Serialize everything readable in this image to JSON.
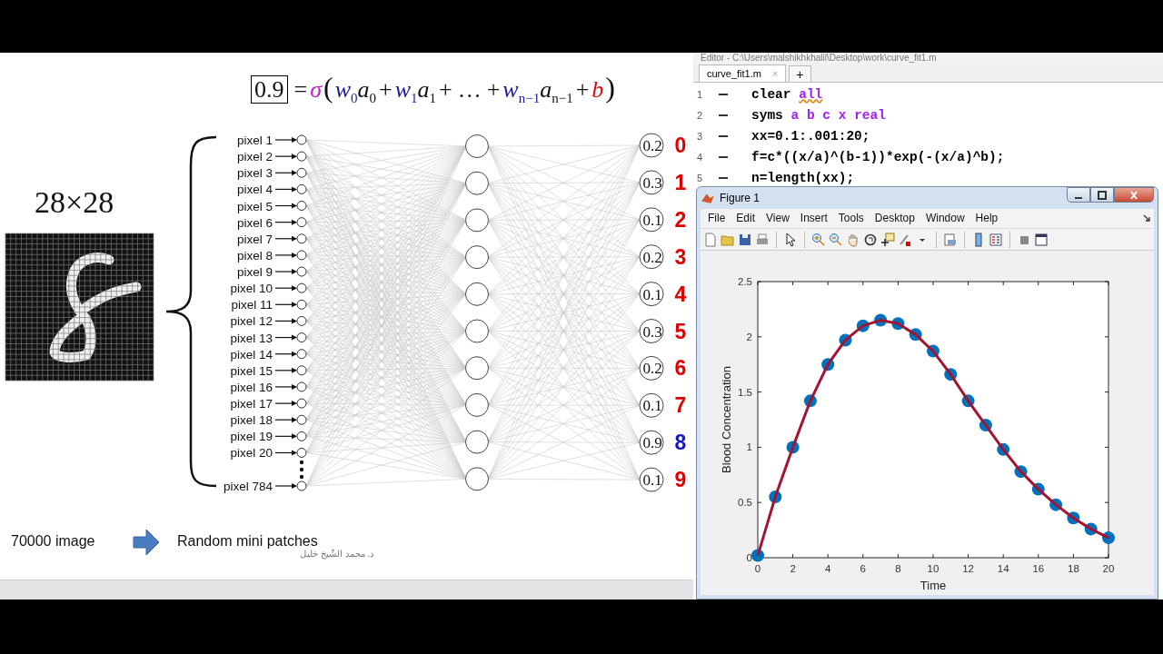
{
  "slide": {
    "equation": {
      "output": "0.9",
      "terms": [
        {
          "text": "=",
          "kind": "operator"
        },
        {
          "text": "σ",
          "kind": "sigma"
        },
        {
          "text": "(",
          "kind": "paren"
        },
        {
          "text": "w$_{0}$",
          "kind": "weight"
        },
        {
          "text": "a$_{0}$",
          "kind": "activation"
        },
        {
          "text": "+",
          "kind": "operator"
        },
        {
          "text": "w$_{1}$",
          "kind": "weight"
        },
        {
          "text": "a$_{1}$",
          "kind": "activation"
        },
        {
          "text": "+",
          "kind": "operator"
        },
        {
          "text": "…",
          "kind": "operator"
        },
        {
          "text": "+",
          "kind": "operator"
        },
        {
          "text": "w$_{n−1}$",
          "kind": "weight"
        },
        {
          "text": "a$_{n−1}$",
          "kind": "activation"
        },
        {
          "text": "+",
          "kind": "operator"
        },
        {
          "text": "b",
          "kind": "bias"
        },
        {
          "text": ")",
          "kind": "paren"
        }
      ]
    },
    "image_size": "28×28",
    "inputs": [
      "pixel 1",
      "pixel 2",
      "pixel 3",
      "pixel 4",
      "pixel 5",
      "pixel 6",
      "pixel 7",
      "pixel 8",
      "pixel 9",
      "pixel 10",
      "pixel 11",
      "pixel 12",
      "pixel 13",
      "pixel 14",
      "pixel 15",
      "pixel 16",
      "pixel 17",
      "pixel 18",
      "pixel 19",
      "pixel 20"
    ],
    "last_input": "pixel 784",
    "outputs": [
      {
        "value": "0.2",
        "digit": "0",
        "selected": false
      },
      {
        "value": "0.3",
        "digit": "1",
        "selected": false
      },
      {
        "value": "0.1",
        "digit": "2",
        "selected": false
      },
      {
        "value": "0.2",
        "digit": "3",
        "selected": false
      },
      {
        "value": "0.1",
        "digit": "4",
        "selected": false
      },
      {
        "value": "0.3",
        "digit": "5",
        "selected": false
      },
      {
        "value": "0.2",
        "digit": "6",
        "selected": false
      },
      {
        "value": "0.1",
        "digit": "7",
        "selected": false
      },
      {
        "value": "0.9",
        "digit": "8",
        "selected": true
      },
      {
        "value": "0.1",
        "digit": "9",
        "selected": false
      }
    ],
    "note_left": "70000 image",
    "note_right": "Random mini patches",
    "author": "د. محمد الشّيخ خليل"
  },
  "editor": {
    "title": "Editor - C:\\Users\\malshikhkhalil\\Desktop\\work\\curve_fit1.m",
    "tabs": [
      {
        "label": "curve_fit1.m",
        "close": "×",
        "selected": true
      }
    ],
    "new_tab": "+",
    "lines": [
      {
        "number": "1",
        "warning": true,
        "segments": [
          {
            "text": "clear ",
            "kind": "plain"
          },
          {
            "text": "all",
            "kind": "string"
          }
        ]
      },
      {
        "number": "2",
        "warning": false,
        "segments": [
          {
            "text": "syms ",
            "kind": "plain"
          },
          {
            "text": "a b c x real",
            "kind": "string"
          }
        ]
      },
      {
        "number": "3",
        "warning": false,
        "segments": [
          {
            "text": "xx=0.1:.001:20;",
            "kind": "plain"
          }
        ]
      },
      {
        "number": "4",
        "warning": false,
        "segments": [
          {
            "text": "f=c*((x/a)^(b-1))*exp(-(x/a)^b);",
            "kind": "plain"
          }
        ]
      },
      {
        "number": "5",
        "warning": false,
        "segments": [
          {
            "text": "n=length(xx);",
            "kind": "plain"
          }
        ]
      }
    ]
  },
  "figure": {
    "title": "Figure 1",
    "menu": [
      "File",
      "Edit",
      "View",
      "Insert",
      "Tools",
      "Desktop",
      "Window",
      "Help"
    ],
    "chart_data": {
      "type": "scatter",
      "xlabel": "Time",
      "ylabel": "Blood Concentration",
      "x": [
        0,
        1,
        2,
        3,
        4,
        5,
        6,
        7,
        8,
        9,
        10,
        11,
        12,
        13,
        14,
        15,
        16,
        17,
        18,
        19,
        20
      ],
      "series": [
        {
          "type": "scatter",
          "color": "#0072bd",
          "values": [
            0.02,
            0.55,
            1.0,
            1.42,
            1.75,
            1.97,
            2.1,
            2.15,
            2.12,
            2.02,
            1.87,
            1.66,
            1.42,
            1.2,
            0.98,
            0.78,
            0.62,
            0.48,
            0.36,
            0.26,
            0.18
          ]
        },
        {
          "type": "line",
          "color": "#a2142f",
          "values": [
            0.02,
            0.55,
            1.0,
            1.42,
            1.75,
            1.97,
            2.1,
            2.15,
            2.12,
            2.02,
            1.87,
            1.66,
            1.42,
            1.2,
            0.98,
            0.78,
            0.62,
            0.48,
            0.36,
            0.26,
            0.18
          ]
        }
      ],
      "xlim": [
        0,
        20
      ],
      "ylim": [
        0,
        2.5
      ],
      "xticks": [
        0,
        2,
        4,
        6,
        8,
        10,
        12,
        14,
        16,
        18,
        20
      ],
      "yticks": [
        0,
        0.5,
        1,
        1.5,
        2,
        2.5
      ]
    }
  }
}
